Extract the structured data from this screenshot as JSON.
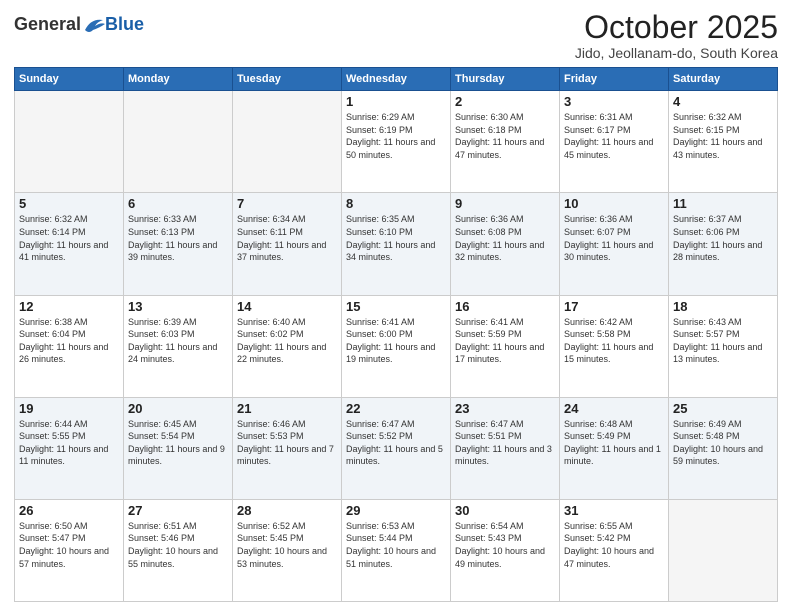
{
  "logo": {
    "general": "General",
    "blue": "Blue"
  },
  "header": {
    "month": "October 2025",
    "location": "Jido, Jeollanam-do, South Korea"
  },
  "weekdays": [
    "Sunday",
    "Monday",
    "Tuesday",
    "Wednesday",
    "Thursday",
    "Friday",
    "Saturday"
  ],
  "rows": [
    [
      {
        "day": "",
        "empty": true
      },
      {
        "day": "",
        "empty": true
      },
      {
        "day": "",
        "empty": true
      },
      {
        "day": "1",
        "rise": "6:29 AM",
        "set": "6:19 PM",
        "daylight": "11 hours and 50 minutes."
      },
      {
        "day": "2",
        "rise": "6:30 AM",
        "set": "6:18 PM",
        "daylight": "11 hours and 47 minutes."
      },
      {
        "day": "3",
        "rise": "6:31 AM",
        "set": "6:17 PM",
        "daylight": "11 hours and 45 minutes."
      },
      {
        "day": "4",
        "rise": "6:32 AM",
        "set": "6:15 PM",
        "daylight": "11 hours and 43 minutes."
      }
    ],
    [
      {
        "day": "5",
        "rise": "6:32 AM",
        "set": "6:14 PM",
        "daylight": "11 hours and 41 minutes."
      },
      {
        "day": "6",
        "rise": "6:33 AM",
        "set": "6:13 PM",
        "daylight": "11 hours and 39 minutes."
      },
      {
        "day": "7",
        "rise": "6:34 AM",
        "set": "6:11 PM",
        "daylight": "11 hours and 37 minutes."
      },
      {
        "day": "8",
        "rise": "6:35 AM",
        "set": "6:10 PM",
        "daylight": "11 hours and 34 minutes."
      },
      {
        "day": "9",
        "rise": "6:36 AM",
        "set": "6:08 PM",
        "daylight": "11 hours and 32 minutes."
      },
      {
        "day": "10",
        "rise": "6:36 AM",
        "set": "6:07 PM",
        "daylight": "11 hours and 30 minutes."
      },
      {
        "day": "11",
        "rise": "6:37 AM",
        "set": "6:06 PM",
        "daylight": "11 hours and 28 minutes."
      }
    ],
    [
      {
        "day": "12",
        "rise": "6:38 AM",
        "set": "6:04 PM",
        "daylight": "11 hours and 26 minutes."
      },
      {
        "day": "13",
        "rise": "6:39 AM",
        "set": "6:03 PM",
        "daylight": "11 hours and 24 minutes."
      },
      {
        "day": "14",
        "rise": "6:40 AM",
        "set": "6:02 PM",
        "daylight": "11 hours and 22 minutes."
      },
      {
        "day": "15",
        "rise": "6:41 AM",
        "set": "6:00 PM",
        "daylight": "11 hours and 19 minutes."
      },
      {
        "day": "16",
        "rise": "6:41 AM",
        "set": "5:59 PM",
        "daylight": "11 hours and 17 minutes."
      },
      {
        "day": "17",
        "rise": "6:42 AM",
        "set": "5:58 PM",
        "daylight": "11 hours and 15 minutes."
      },
      {
        "day": "18",
        "rise": "6:43 AM",
        "set": "5:57 PM",
        "daylight": "11 hours and 13 minutes."
      }
    ],
    [
      {
        "day": "19",
        "rise": "6:44 AM",
        "set": "5:55 PM",
        "daylight": "11 hours and 11 minutes."
      },
      {
        "day": "20",
        "rise": "6:45 AM",
        "set": "5:54 PM",
        "daylight": "11 hours and 9 minutes."
      },
      {
        "day": "21",
        "rise": "6:46 AM",
        "set": "5:53 PM",
        "daylight": "11 hours and 7 minutes."
      },
      {
        "day": "22",
        "rise": "6:47 AM",
        "set": "5:52 PM",
        "daylight": "11 hours and 5 minutes."
      },
      {
        "day": "23",
        "rise": "6:47 AM",
        "set": "5:51 PM",
        "daylight": "11 hours and 3 minutes."
      },
      {
        "day": "24",
        "rise": "6:48 AM",
        "set": "5:49 PM",
        "daylight": "11 hours and 1 minute."
      },
      {
        "day": "25",
        "rise": "6:49 AM",
        "set": "5:48 PM",
        "daylight": "10 hours and 59 minutes."
      }
    ],
    [
      {
        "day": "26",
        "rise": "6:50 AM",
        "set": "5:47 PM",
        "daylight": "10 hours and 57 minutes."
      },
      {
        "day": "27",
        "rise": "6:51 AM",
        "set": "5:46 PM",
        "daylight": "10 hours and 55 minutes."
      },
      {
        "day": "28",
        "rise": "6:52 AM",
        "set": "5:45 PM",
        "daylight": "10 hours and 53 minutes."
      },
      {
        "day": "29",
        "rise": "6:53 AM",
        "set": "5:44 PM",
        "daylight": "10 hours and 51 minutes."
      },
      {
        "day": "30",
        "rise": "6:54 AM",
        "set": "5:43 PM",
        "daylight": "10 hours and 49 minutes."
      },
      {
        "day": "31",
        "rise": "6:55 AM",
        "set": "5:42 PM",
        "daylight": "10 hours and 47 minutes."
      },
      {
        "day": "",
        "empty": true
      }
    ]
  ],
  "labels": {
    "sunrise": "Sunrise:",
    "sunset": "Sunset:",
    "daylight": "Daylight:"
  }
}
